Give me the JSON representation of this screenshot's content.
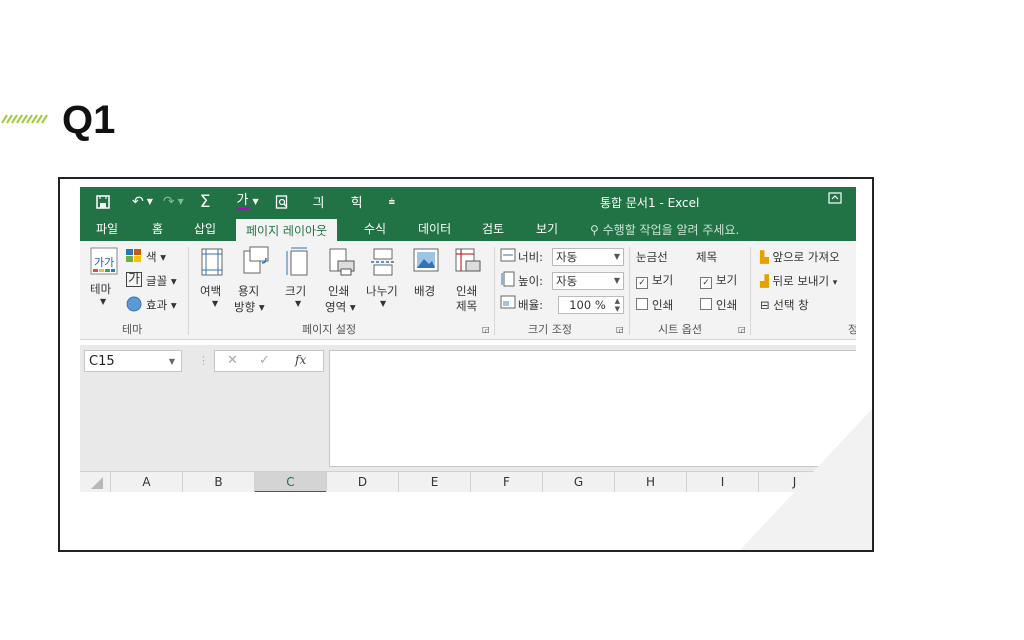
{
  "heading": {
    "label": "Q1"
  },
  "colors": {
    "excel_green": "#217346",
    "heading_mark": "#9acd32"
  },
  "excel": {
    "quick_access": {
      "icons": [
        "save-icon",
        "undo-icon",
        "redo-icon",
        "autosum-icon",
        "font-color-icon",
        "print-preview-icon",
        "sort-ascending-icon",
        "sort-descending-icon",
        "customize-qat-icon"
      ],
      "sigma": "Σ",
      "font_color": "가",
      "sort_asc": "긔",
      "sort_desc": "힉"
    },
    "window_title": "통합 문서1 - Excel",
    "tabs": [
      "파일",
      "홈",
      "삽입",
      "페이지 레이아웃",
      "수식",
      "데이터",
      "검토",
      "보기"
    ],
    "active_tab": "페이지 레이아웃",
    "tell_me": "수행할 작업을 알려 주세요.",
    "ribbon": {
      "theme_group": {
        "themes_label": "테마",
        "colors_label": "색",
        "fonts_label": "글꼴",
        "effects_label": "효과",
        "group_label": "테마"
      },
      "page_setup_group": {
        "margins": "여백",
        "orientation": [
          "용지",
          "방향"
        ],
        "size": "크기",
        "print_area": [
          "인쇄",
          "영역"
        ],
        "breaks": "나누기",
        "background": "배경",
        "print_titles": [
          "인쇄",
          "제목"
        ],
        "group_label": "페이지 설정"
      },
      "scale_group": {
        "width_label": "너비:",
        "width_value": "자동",
        "height_label": "높이:",
        "height_value": "자동",
        "scale_label": "배율:",
        "scale_value": "100 %",
        "group_label": "크기 조정"
      },
      "sheet_options_group": {
        "gridlines": "눈금선",
        "headings": "제목",
        "view": "보기",
        "print": "인쇄",
        "gridlines_view_checked": true,
        "headings_view_checked": true,
        "group_label": "시트 옵션"
      },
      "arrange_group": {
        "bring_forward": "앞으로 가져오",
        "send_backward": "뒤로 보내기",
        "selection_pane": "선택 창",
        "group_label_partial": "정"
      }
    },
    "name_box": "C15",
    "fx_label": "fx",
    "cancel_symbol": "✕",
    "enter_symbol": "✓",
    "columns": [
      "A",
      "B",
      "C",
      "D",
      "E",
      "F",
      "G",
      "H",
      "I",
      "J"
    ],
    "selected_column": "C"
  }
}
